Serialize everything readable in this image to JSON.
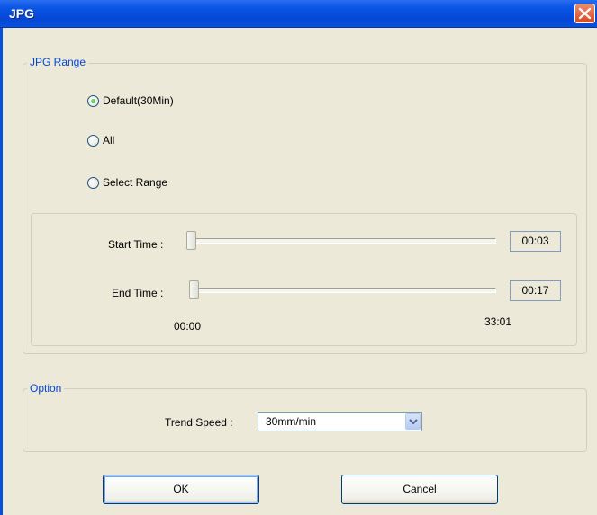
{
  "window": {
    "title": "JPG"
  },
  "jpg_range": {
    "group_label": "JPG Range",
    "options": [
      {
        "label": "Default(30Min)",
        "checked": true
      },
      {
        "label": "All",
        "checked": false
      },
      {
        "label": "Select Range",
        "checked": false
      }
    ],
    "start_time_label": "Start Time :",
    "start_time_value": "00:03",
    "start_slider_fraction": 0.0,
    "end_time_label": "End Time :",
    "end_time_value": "00:17",
    "end_slider_fraction": 0.009,
    "range_min": "00:00",
    "range_max": "33:01"
  },
  "option": {
    "group_label": "Option",
    "trend_speed_label": "Trend Speed :",
    "trend_speed_value": "30mm/min"
  },
  "buttons": {
    "ok": "OK",
    "cancel": "Cancel"
  },
  "icons": {
    "close": "close-icon",
    "dropdown": "chevron-down-icon"
  },
  "colors": {
    "title_bar": "#0a55e6",
    "dialog_bg": "#ece9d8",
    "group_label": "#0046d5",
    "close": "#d9481e"
  }
}
